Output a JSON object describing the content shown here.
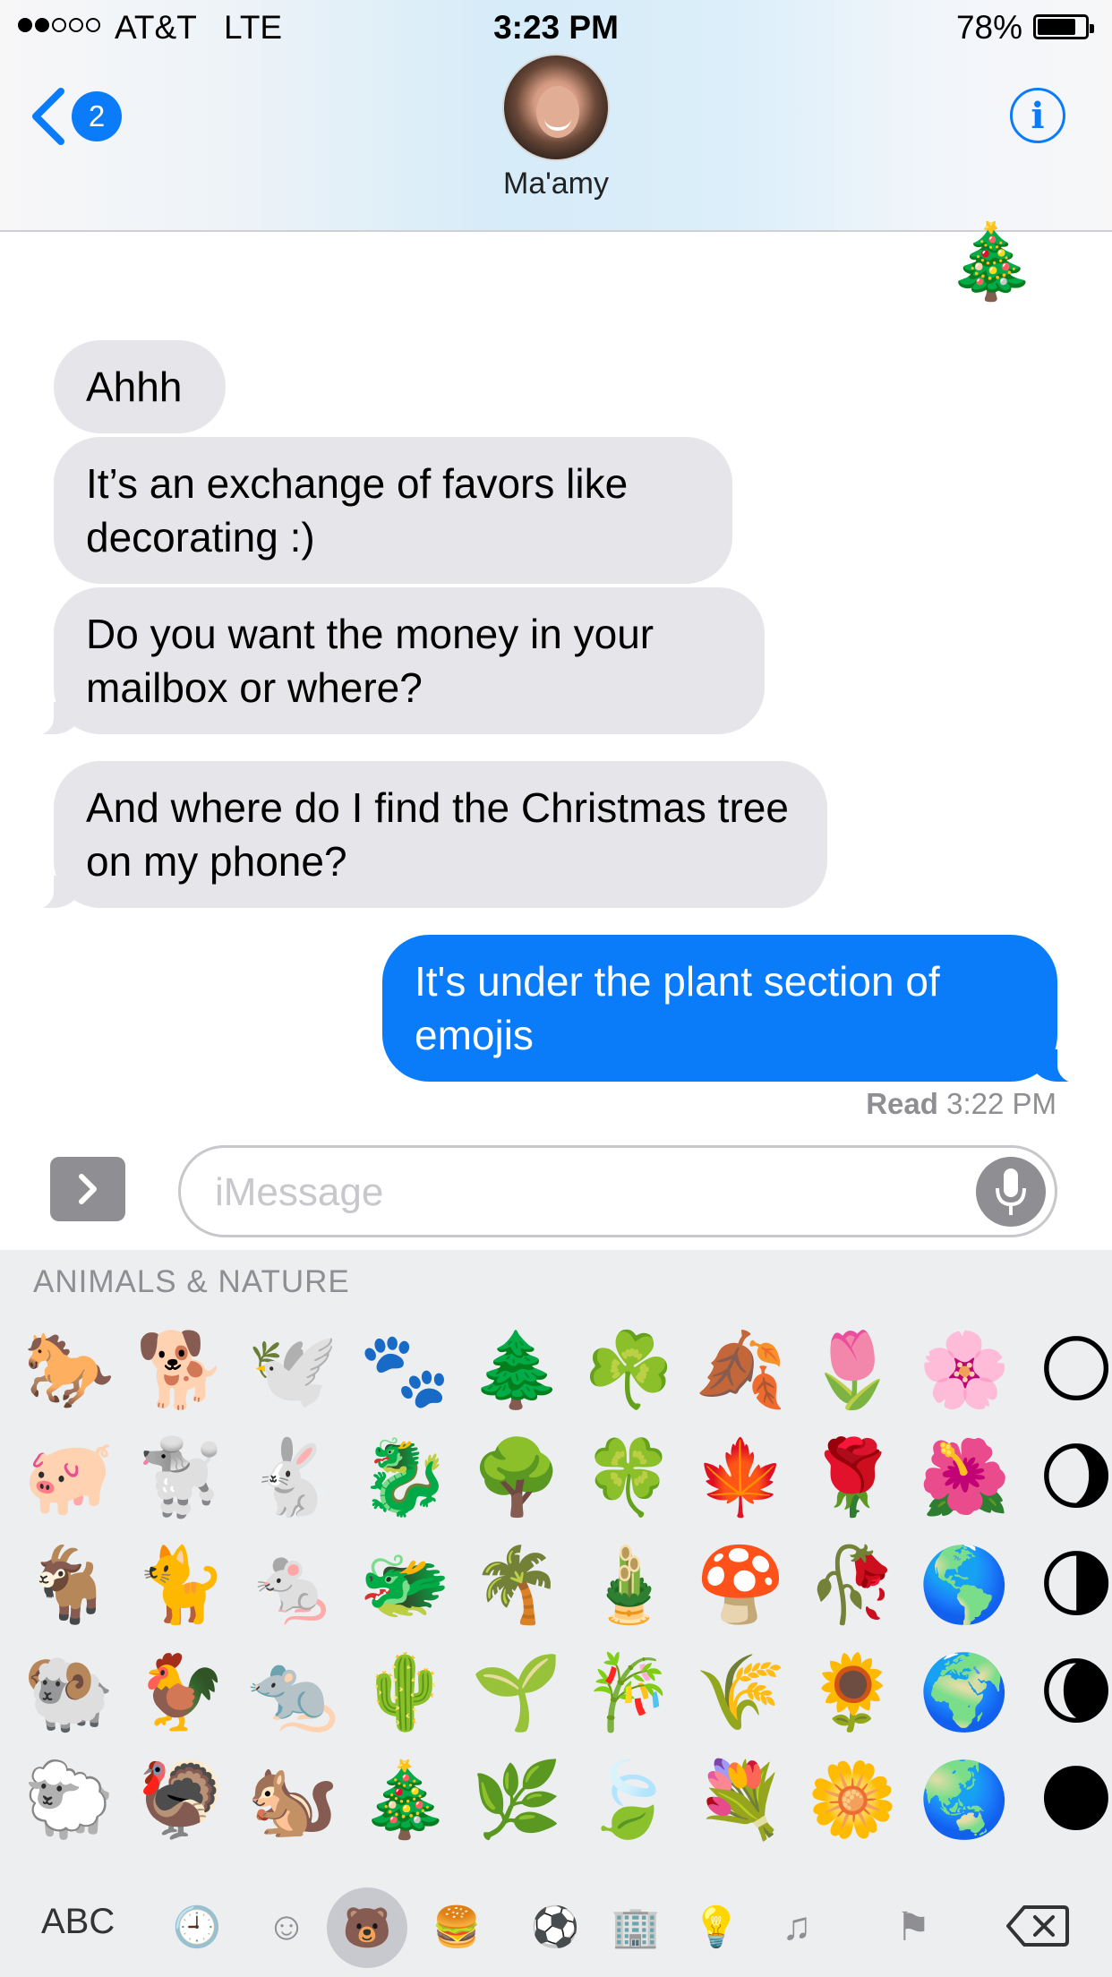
{
  "status_bar": {
    "signal_full": 2,
    "signal_total": 5,
    "carrier": "AT&T   LTE",
    "time": "3:23 PM",
    "battery_pct": "78%",
    "battery_level": 0.78
  },
  "header": {
    "back_badge": "2",
    "contact_name": "Ma'amy",
    "info_icon": "i"
  },
  "conversation": {
    "sent_emoji": "🎄",
    "messages": [
      {
        "from": "them",
        "text": "Ahhh"
      },
      {
        "from": "them",
        "text": "It’s an exchange of favors like decorating :)"
      },
      {
        "from": "them",
        "text": "Do you want the money in your mailbox or where?"
      },
      {
        "from": "them",
        "text": "And where do I find the Christmas tree on my phone?"
      },
      {
        "from": "me",
        "text": "It's under the plant section of emojis"
      }
    ],
    "read_label": "Read",
    "read_time": "3:22 PM"
  },
  "compose": {
    "placeholder": "iMessage"
  },
  "keyboard": {
    "section_title": "ANIMALS & NATURE",
    "columns": [
      [
        "🐎",
        "🐖",
        "🐐",
        "🐏",
        "🐑"
      ],
      [
        "🐕",
        "🐩",
        "🐈",
        "🐓",
        "🦃"
      ],
      [
        "🕊️",
        "🐇",
        "🐁",
        "🐀",
        "🐿️"
      ],
      [
        "🐾",
        "🐉",
        "🐲",
        "🌵",
        "🎄"
      ],
      [
        "🌲",
        "🌳",
        "🌴",
        "🌱",
        "🌿"
      ],
      [
        "☘️",
        "🍀",
        "🎍",
        "🎋",
        "🍃"
      ],
      [
        "🍂",
        "🍁",
        "🍄",
        "🌾",
        "💐"
      ],
      [
        "🌷",
        "🌹",
        "🥀",
        "🌻",
        "🌼"
      ],
      [
        "🌸",
        "🌺",
        "🌎",
        "🌍",
        "🌏"
      ],
      [
        "🌕",
        "🌖",
        "🌗",
        "🌘",
        "🌑"
      ]
    ],
    "abc_label": "ABC",
    "categories": [
      {
        "name": "recent-icon",
        "glyph": "🕘"
      },
      {
        "name": "smileys-icon",
        "glyph": "☺"
      },
      {
        "name": "animals-icon",
        "glyph": "🐻",
        "active": true
      },
      {
        "name": "food-icon",
        "glyph": "🍔"
      },
      {
        "name": "activity-icon",
        "glyph": "⚽"
      },
      {
        "name": "travel-icon",
        "glyph": "🏢"
      },
      {
        "name": "objects-icon",
        "glyph": "💡"
      },
      {
        "name": "symbols-icon",
        "glyph": "♫"
      },
      {
        "name": "flags-icon",
        "glyph": "⚑"
      }
    ]
  },
  "colors": {
    "accent": "#0a7cf9",
    "received_bubble": "#e5e5ea",
    "sent_bubble": "#0a7cf9",
    "keyboard_bg": "#eceef0"
  }
}
